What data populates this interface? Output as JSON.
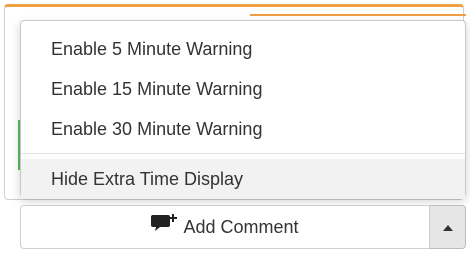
{
  "dropdown": {
    "items": [
      {
        "label": "Enable 5 Minute Warning"
      },
      {
        "label": "Enable 15 Minute Warning"
      },
      {
        "label": "Enable 30 Minute Warning"
      }
    ],
    "extra_item": {
      "label": "Hide Extra Time Display"
    }
  },
  "comment_button": {
    "label": "Add Comment",
    "icon": "comment-plus-icon"
  },
  "toggle_button": {
    "icon": "caret-up-icon"
  },
  "colors": {
    "accent_orange": "#f0a043",
    "accent_green": "#5cb85c",
    "hover_bg": "#f2f2f2",
    "toggle_bg": "#e6e6e6"
  }
}
